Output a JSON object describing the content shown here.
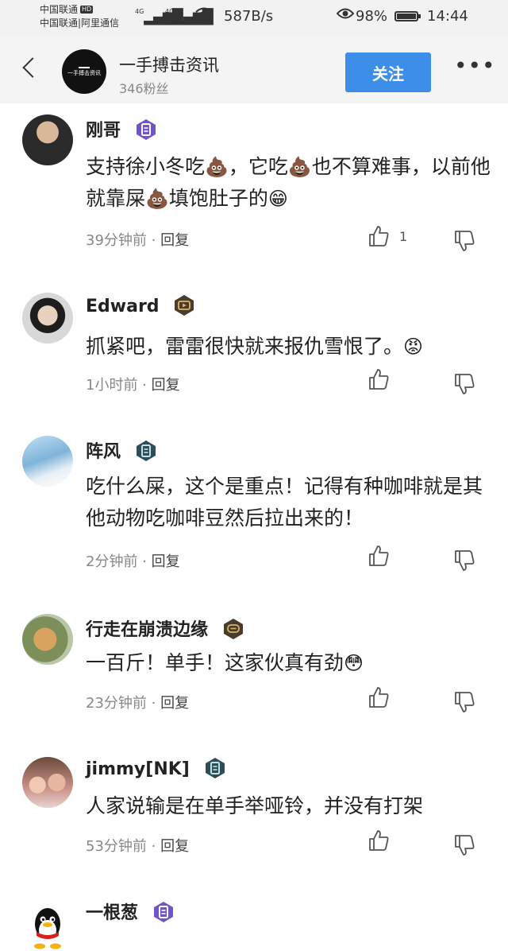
{
  "status_bar": {
    "carrier_1": "中国联通",
    "hd": "HD",
    "carrier_2": "中国联通|阿里通信",
    "net_1": "4G",
    "net_2": "4G",
    "speed": "587B/s",
    "battery": "98%",
    "battery_level": 0.98,
    "time": "14:44"
  },
  "header": {
    "logo_text": "一手搏击资讯",
    "channel_name": "一手搏击资讯",
    "fans": "346粉丝",
    "follow_label": "关注",
    "more_label": "•••"
  },
  "comments": [
    {
      "user": "刚哥",
      "badge": "document-badge-purple",
      "text_parts": [
        "支持徐小冬吃",
        "💩",
        "，它吃",
        "💩",
        "也不算难事，以前他就靠屎",
        "💩",
        "填饱肚子的",
        "😁"
      ],
      "time": "39分钟前",
      "reply": "回复",
      "likes": "1"
    },
    {
      "user": "Edward",
      "badge": "video-badge-gold",
      "text_parts": [
        "抓紧吧，雷雷很快就来报仇雪恨了。",
        "😡"
      ],
      "time": "1小时前",
      "reply": "回复",
      "likes": ""
    },
    {
      "user": "阵风",
      "badge": "document-badge-teal",
      "text_parts": [
        "吃什么屎，这个是重点！记得有种咖啡就是其他动物吃咖啡豆然后拉出来的！"
      ],
      "time": "2分钟前",
      "reply": "回复",
      "likes": ""
    },
    {
      "user": "行走在崩溃边缘",
      "badge": "chat-badge-gold",
      "text_parts": [
        "一百斤！单手！这家伙真有劲",
        "😳"
      ],
      "time": "23分钟前",
      "reply": "回复",
      "likes": ""
    },
    {
      "user": "jimmy[NK]",
      "badge": "document-badge-teal",
      "text_parts": [
        "人家说输是在单手举哑铃，并没有打架"
      ],
      "time": "53分钟前",
      "reply": "回复",
      "likes": ""
    },
    {
      "user": "一根葱",
      "badge": "document-badge-purple",
      "text_parts": [],
      "time": "",
      "reply": "",
      "likes": ""
    }
  ]
}
